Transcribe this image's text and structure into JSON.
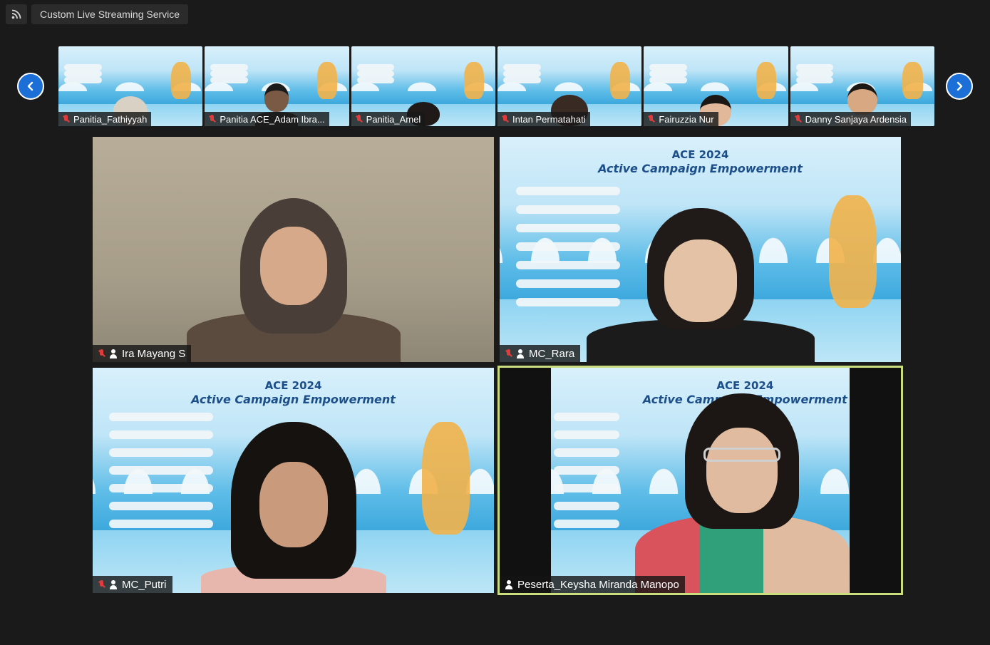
{
  "window": {
    "title": "Custom Live Streaming Service"
  },
  "icons": {
    "rss": "rss-icon",
    "prev": "chevron-left-icon",
    "next": "chevron-right-icon",
    "mic_off": "mic-off-icon",
    "spotlight": "person-icon"
  },
  "colors": {
    "background": "#1a1a1a",
    "nav_arrow": "#1d6fd8",
    "active_speaker_border": "#c9dc7e",
    "mic_off": "#e23b3b"
  },
  "thumbnails": [
    {
      "name": "Panitia_Fathiyyah"
    },
    {
      "name": "Panitia ACE_Adam Ibra..."
    },
    {
      "name": "Panitia_Amel"
    },
    {
      "name": "Intan Permatahati"
    },
    {
      "name": "Fairuzzia Nur"
    },
    {
      "name": "Danny Sanjaya Ardensia"
    }
  ],
  "slide": {
    "title": "ACE 2024",
    "subtitle": "Active Campaign Empowerment"
  },
  "tiles": [
    {
      "name": "Ira Mayang S"
    },
    {
      "name": "MC_Rara"
    },
    {
      "name": "MC_Putri"
    },
    {
      "name": "Peserta_Keysha Miranda Manopo"
    }
  ]
}
